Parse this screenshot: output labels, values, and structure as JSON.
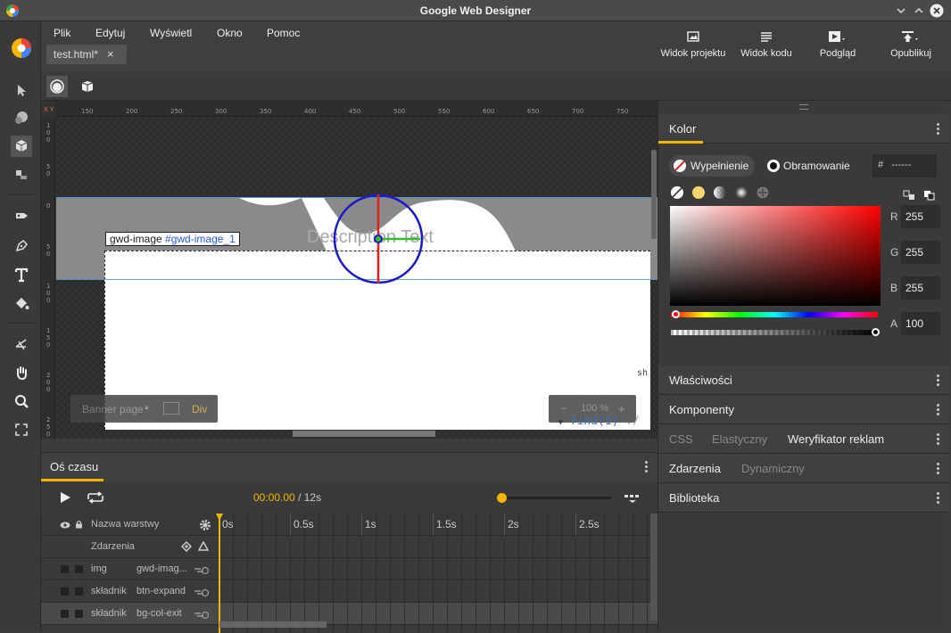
{
  "window": {
    "title": "Google Web Designer"
  },
  "menu": [
    "Plik",
    "Edytuj",
    "Wyświetl",
    "Okno",
    "Pomoc"
  ],
  "file_tab": {
    "label": "test.html",
    "modified": "*",
    "close": "×"
  },
  "header_buttons": {
    "design_view": "Widok projektu",
    "code_view": "Widok kodu",
    "preview": "Podgląd",
    "publish": "Opublikuj"
  },
  "ruler": {
    "corner": "X Y",
    "h_ticks": [
      "150",
      "200",
      "250",
      "300",
      "350",
      "400",
      "450",
      "500",
      "550",
      "600",
      "650",
      "700",
      "750"
    ],
    "v_ticks": [
      "100",
      "50",
      "0",
      "50",
      "100",
      "150",
      "200",
      "250"
    ]
  },
  "stage": {
    "description_text": "Description Text",
    "selected_tag": "gwd-image",
    "selected_id": "#gwd-image_1",
    "banner_page": "Banner page",
    "element_type": "Div",
    "zoom_minus": "–",
    "zoom": "100 %",
    "zoom_plus": "+",
    "code_fragment": "find(1)",
    "code_fragment2": "./",
    "code_fragment3": "sh"
  },
  "timeline": {
    "title": "Oś czasu",
    "current_time": "00:00.00",
    "total_time": "/ 12s",
    "layer_name_header": "Nazwa warstwy",
    "events_row": "Zdarzenia",
    "ticks": [
      "0s",
      "0.5s",
      "1s",
      "1.5s",
      "2s",
      "2.5s"
    ],
    "layers": [
      {
        "type": "img",
        "name": "gwd-imag..."
      },
      {
        "type": "składnik",
        "name": "btn-expand"
      },
      {
        "type": "składnik",
        "name": "bg-col-exit"
      }
    ]
  },
  "color_panel": {
    "title": "Kolor",
    "fill": "Wypełnienie",
    "stroke": "Obramowanie",
    "hex_prefix": "#",
    "hex_value": "------",
    "channels": [
      {
        "label": "R",
        "value": "255"
      },
      {
        "label": "G",
        "value": "255"
      },
      {
        "label": "B",
        "value": "255"
      },
      {
        "label": "A",
        "value": "100"
      }
    ]
  },
  "panels": {
    "properties": "Właściwości",
    "components": "Komponenty",
    "css": "CSS",
    "flexible": "Elastyczny",
    "ad_validator": "Weryfikator reklam",
    "events": "Zdarzenia",
    "dynamic": "Dynamiczny",
    "library": "Biblioteka"
  },
  "colors": {
    "accent": "#f4b400",
    "selection_circle": "#1a1ac8",
    "crosshair_v": "#e02020",
    "crosshair_h": "#30c030"
  }
}
